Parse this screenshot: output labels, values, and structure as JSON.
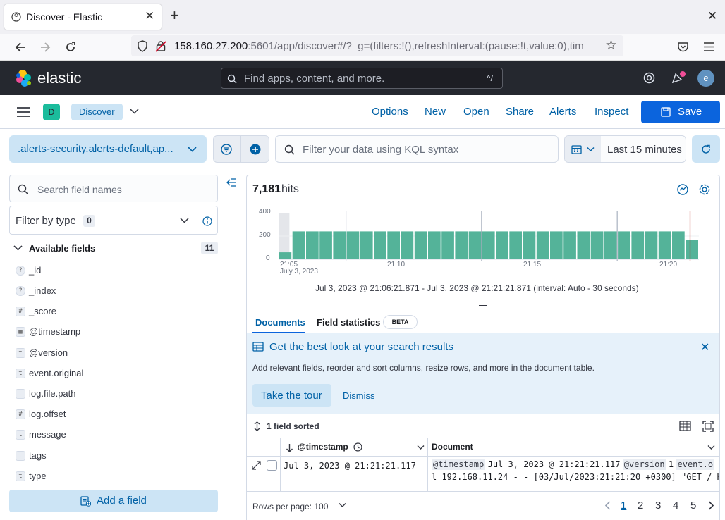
{
  "browser": {
    "tab_title": "Discover - Elastic",
    "url_host": "158.160.27.200",
    "url_rest": ":5601/app/discover#/?_g=(filters:!(),refreshInterval:(pause:!t,value:0),tim"
  },
  "kibana": {
    "brand": "elastic",
    "search_placeholder": "Find apps, content, and more.",
    "search_shortcut": "^/",
    "user_initial": "e"
  },
  "app_header": {
    "space_initial": "D",
    "breadcrumb": "Discover",
    "nav": [
      "Options",
      "New",
      "Open",
      "Share",
      "Alerts",
      "Inspect"
    ],
    "save_label": "Save"
  },
  "query_bar": {
    "data_view": ".alerts-security.alerts-default,ap...",
    "kql_placeholder": "Filter your data using KQL syntax",
    "time_range": "Last 15 minutes"
  },
  "sidebar": {
    "search_placeholder": "Search field names",
    "filter_label": "Filter by type",
    "filter_count": "0",
    "available_label": "Available fields",
    "available_count": "11",
    "fields": [
      {
        "name": "_id",
        "type": "?"
      },
      {
        "name": "_index",
        "type": "?"
      },
      {
        "name": "_score",
        "type": "#"
      },
      {
        "name": "@timestamp",
        "type": "cal"
      },
      {
        "name": "@version",
        "type": "t"
      },
      {
        "name": "event.original",
        "type": "t"
      },
      {
        "name": "log.file.path",
        "type": "t"
      },
      {
        "name": "log.offset",
        "type": "#"
      },
      {
        "name": "message",
        "type": "t"
      },
      {
        "name": "tags",
        "type": "t"
      },
      {
        "name": "type",
        "type": "t"
      }
    ],
    "add_field_label": "Add a field"
  },
  "hits": {
    "count": "7,181",
    "label": "hits"
  },
  "chart_data": {
    "type": "bar",
    "yticks": [
      "400",
      "200",
      "0"
    ],
    "ylim": [
      0,
      400
    ],
    "xticks": [
      "21:05",
      "21:10",
      "21:15",
      "21:20"
    ],
    "xsublabel": "July 3, 2023",
    "values": [
      60,
      240,
      240,
      240,
      240,
      240,
      240,
      240,
      240,
      240,
      240,
      240,
      240,
      240,
      240,
      240,
      240,
      240,
      240,
      240,
      240,
      240,
      240,
      240,
      240,
      240,
      240,
      240,
      240,
      240,
      170
    ],
    "range_label": "Jul 3, 2023 @ 21:06:21.871 - Jul 3, 2023 @ 21:21:21.871 (interval: Auto - 30 seconds)",
    "bar_color": "#54b399"
  },
  "tabs": {
    "documents": "Documents",
    "field_stats": "Field statistics",
    "beta": "BETA"
  },
  "callout": {
    "title": "Get the best look at your search results",
    "body": "Add relevant fields, reorder and sort columns, resize rows, and more in the document table.",
    "tour": "Take the tour",
    "dismiss": "Dismiss"
  },
  "table": {
    "sorted_label": "1 field sorted",
    "col_timestamp": "@timestamp",
    "col_document": "Document",
    "row_time": "Jul 3, 2023 @ 21:21:21.117",
    "doc_line1_k1": "@timestamp",
    "doc_line1_v1": "Jul 3, 2023 @ 21:21:21.117",
    "doc_line1_k2": "@version",
    "doc_line1_v2": "1",
    "doc_line1_k3": "event.o",
    "doc_line2": "l 192.168.11.24 - - [03/Jul/2023:21:21:20 +0300] \"GET / H",
    "rows_per_page": "Rows per page: 100",
    "pages": [
      "1",
      "2",
      "3",
      "4",
      "5"
    ]
  }
}
